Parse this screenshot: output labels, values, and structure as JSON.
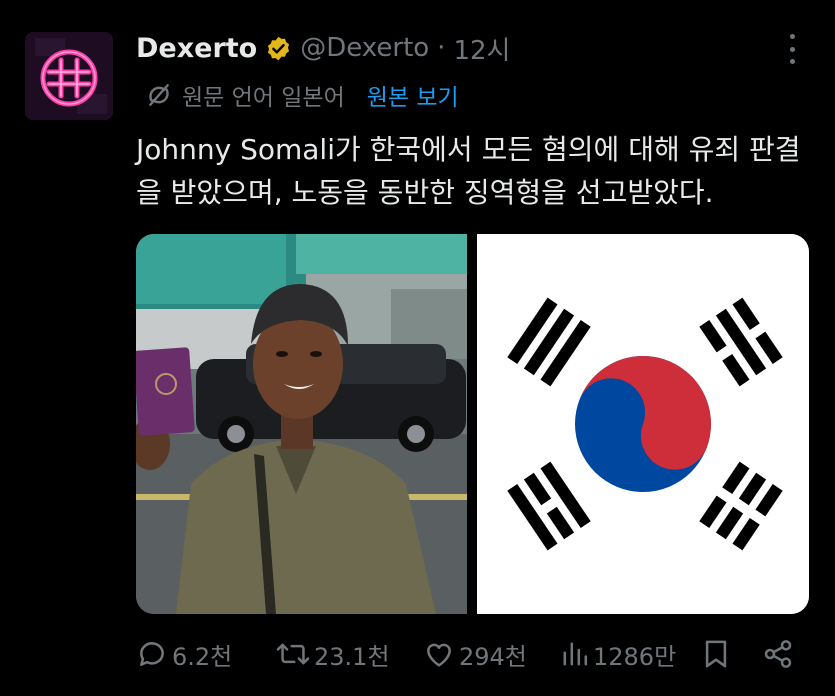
{
  "tweet": {
    "author_name": "Dexerto",
    "handle": "@Dexerto",
    "separator": "·",
    "time": "12시",
    "translation_note": "원문 언어 일본어",
    "view_original": "원본 보기",
    "text": "Johnny Somali가 한국에서 모든 혐의에 대해 유죄 판결을 받았으며, 노동을 동반한 징역형을 선고받았다."
  },
  "actions": {
    "replies": "6.2천",
    "retweets": "23.1천",
    "likes": "294천",
    "views": "1286만"
  },
  "icons": {
    "avatar": "dexerto-neon-logo",
    "verified": "gold-verified-badge",
    "more": "more-dots-icon",
    "translate": "translate-off-icon",
    "reply": "reply-icon",
    "retweet": "retweet-icon",
    "like": "heart-icon",
    "views": "bar-chart-icon",
    "bookmark": "bookmark-icon",
    "share": "share-icon"
  },
  "colors": {
    "background": "#000000",
    "primary_text": "#e7e9ea",
    "secondary_text": "#71767b",
    "link": "#1d9bf0",
    "verified_gold": "#e2b719",
    "flag_red": "#cd2e3a",
    "flag_blue": "#0047a0"
  }
}
